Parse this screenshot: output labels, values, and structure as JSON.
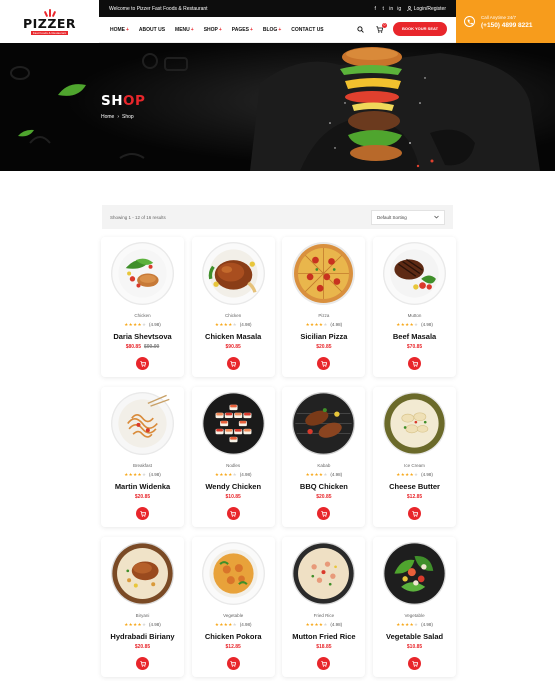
{
  "logo": {
    "text": "PIZZER",
    "tagline": "Fast Foods & Restaurant"
  },
  "topbar": {
    "welcome": "Welcome to Pizzer Fast Foods & Restaurant",
    "social_icons": [
      "facebook-icon",
      "twitter-icon",
      "linkedin-icon",
      "instagram-icon"
    ],
    "social_glyphs": [
      "f",
      "t",
      "in",
      "ig"
    ],
    "login": "Login/Register"
  },
  "nav": {
    "items": [
      {
        "label": "HOME",
        "has_dropdown": true
      },
      {
        "label": "ABOUT US",
        "has_dropdown": false
      },
      {
        "label": "MENU",
        "has_dropdown": true
      },
      {
        "label": "SHOP",
        "has_dropdown": true
      },
      {
        "label": "PAGES",
        "has_dropdown": true
      },
      {
        "label": "BLOG",
        "has_dropdown": true
      },
      {
        "label": "CONTACT US",
        "has_dropdown": false
      }
    ],
    "cart_count": "0",
    "reserve_label": "BOOK YOUR SEAT"
  },
  "contact": {
    "label": "Call Anytime 24/7",
    "phone": "(+150) 4899 8221"
  },
  "banner": {
    "title_main": "SH",
    "title_highlight": "OP",
    "breadcrumb": [
      "Home",
      "Shop"
    ]
  },
  "toolbar": {
    "result_count": "Showing 1 - 12 of 16 results",
    "sort_selected": "Default Sorting"
  },
  "colors": {
    "accent": "#e8262b",
    "orange": "#f79c1c",
    "star": "#f7a81b",
    "dark": "#0d0d0d"
  },
  "products": [
    {
      "category": "Chicken",
      "name": "Daria Shevtsova",
      "price": "$80.85",
      "old_price": "$99.99",
      "rating": "(4.98)",
      "stars": 4,
      "dish": "salad-chicken"
    },
    {
      "category": "Chicken",
      "name": "Chicken Masala",
      "price": "$90.85",
      "old_price": "",
      "rating": "(4.98)",
      "stars": 4,
      "dish": "roast-chicken"
    },
    {
      "category": "Pizza",
      "name": "Sicilian Pizza",
      "price": "$20.85",
      "old_price": "",
      "rating": "(4.98)",
      "stars": 4,
      "dish": "pizza"
    },
    {
      "category": "Mutton",
      "name": "Beef Masala",
      "price": "$70.85",
      "old_price": "",
      "rating": "(4.98)",
      "stars": 4,
      "dish": "steak"
    },
    {
      "category": "Breakfast",
      "name": "Martin Widenka",
      "price": "$20.85",
      "old_price": "",
      "rating": "(4.98)",
      "stars": 4,
      "dish": "noodles"
    },
    {
      "category": "Nodles",
      "name": "Wendy Chicken",
      "price": "$10.85",
      "old_price": "",
      "rating": "(4.98)",
      "stars": 4,
      "dish": "sushi"
    },
    {
      "category": "Kabab",
      "name": "BBQ Chicken",
      "price": "$20.85",
      "old_price": "",
      "rating": "(4.98)",
      "stars": 4,
      "dish": "bbq"
    },
    {
      "category": "Ice Cream",
      "name": "Cheese Butter",
      "price": "$12.85",
      "old_price": "",
      "rating": "(4.98)",
      "stars": 4,
      "dish": "pasta"
    },
    {
      "category": "Biryani",
      "name": "Hydrabadi Biriany",
      "price": "$20.85",
      "old_price": "",
      "rating": "(4.98)",
      "stars": 4,
      "dish": "biryani"
    },
    {
      "category": "Vegetable",
      "name": "Chicken Pokora",
      "price": "$12.85",
      "old_price": "",
      "rating": "(4.98)",
      "stars": 4,
      "dish": "curry"
    },
    {
      "category": "Fried Rice",
      "name": "Mutton Fried Rice",
      "price": "$18.85",
      "old_price": "",
      "rating": "(4.98)",
      "stars": 4,
      "dish": "fried-rice"
    },
    {
      "category": "Vegetable",
      "name": "Vegetable Salad",
      "price": "$10.85",
      "old_price": "",
      "rating": "(4.98)",
      "stars": 4,
      "dish": "veg-salad"
    }
  ]
}
